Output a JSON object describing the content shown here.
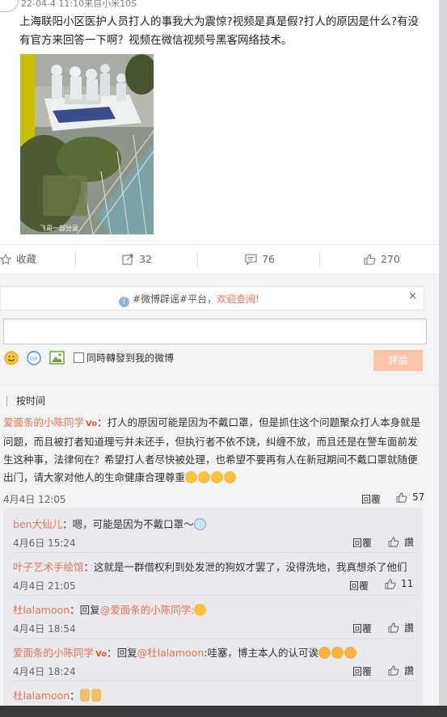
{
  "post": {
    "timestamp": "22-04-4 11:10来自小米10S",
    "text": "上海联阳小区医护人员打人的事我大为震惊?视频是真是假?打人的原因是什么?有没有官方来回答一下啊？视频在微信视频号黑客网络技术。",
    "image_watermark": "飞哥一部分录"
  },
  "actions": {
    "favorite_label": "收藏",
    "forward_count": "32",
    "comment_count": "76",
    "like_count": "270"
  },
  "notice": {
    "hashtag": "#微博辟谣#平台，",
    "link": "欢迎查阅!",
    "close": "×"
  },
  "composer": {
    "input_value": "",
    "forward_label": "同時轉發到我的微博",
    "submit_label": "評論"
  },
  "sort_label": "按时间",
  "comments": [
    {
      "user": "爱面条的小陈同学",
      "text": "：打人的原因可能是因为不戴口罩，但是抓住这个问题聚众打人本身就是问题，而且被打者知道理亏并未还手，但执行者不依不饶，纠缠不放，而且还是在警车面前发生这种事，法律何在？希望打人者尽快被处理，也希望不要再有人在新冠期间不戴口罩就随便出门，请大家对他人的生命健康合理尊重",
      "time": "4月4日 12:05",
      "reply": "回覆",
      "likes": "57"
    }
  ],
  "replies": [
    {
      "user": "ben大仙儿",
      "text": "：嗯，可能是因为不戴口罩～",
      "time": "4月6日 15:24",
      "reply": "回覆",
      "likes": "讚"
    },
    {
      "user": "叶子艺术手绘馆",
      "text": "：这就是一群借权利到处发泄的狗奴才罢了，没得洗地，我真想杀了他们",
      "time": "4月4日 21:05",
      "reply": "回覆",
      "likes": "11"
    },
    {
      "user": "杜lalamoon",
      "text_prefix": "：回复",
      "mention": "@爱面条的小陈同学",
      "text_suffix": ":",
      "time": "4月4日 18:54",
      "reply": "回覆",
      "likes": "讚"
    },
    {
      "user": "爱面条的小陈同学",
      "text_prefix": "：回复",
      "mention": "@杜lalamoon",
      "text_suffix": ":哇塞，博主本人的认可诶",
      "time": "4月4日 18:24",
      "reply": "回覆",
      "likes": "讚"
    },
    {
      "user": "杜lalamoon",
      "text": "："
    }
  ],
  "colors": {
    "accent": "#eb7350",
    "submit_bg": "#fbc5ab"
  }
}
